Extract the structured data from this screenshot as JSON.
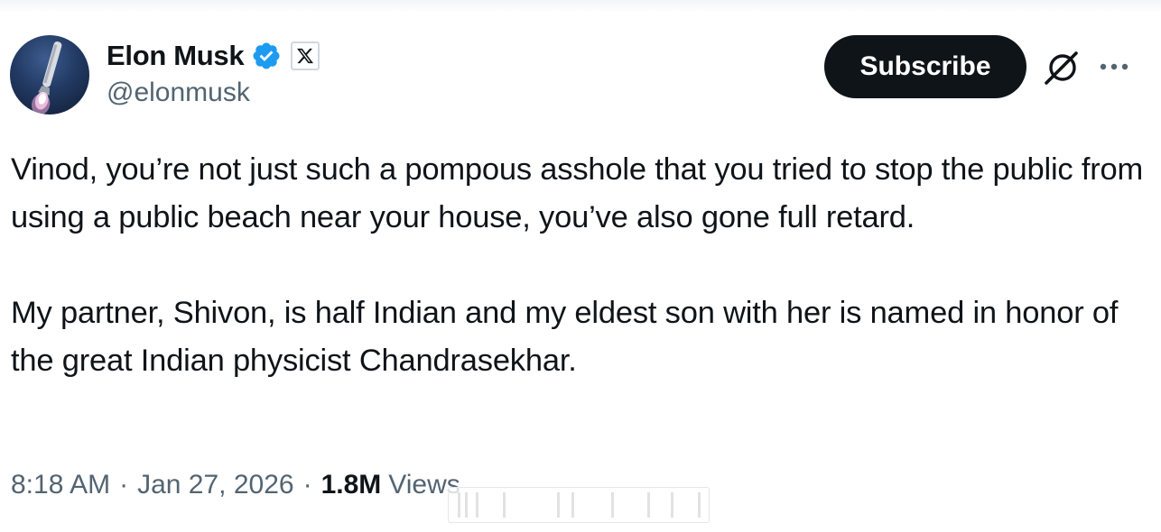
{
  "tweet": {
    "author": {
      "display_name": "Elon Musk",
      "handle": "@elonmusk",
      "verified_icon": "verified-badge-icon",
      "affiliation_icon": "x-logo-icon"
    },
    "actions": {
      "subscribe_label": "Subscribe",
      "grok_icon": "grok-icon",
      "more_icon": "more-options-icon"
    },
    "paragraphs": [
      "Vinod, you’re not just such a pompous asshole that you tried to stop the public from using a public beach near your house, you’ve also gone full retard.",
      "My partner, Shivon, is half Indian and my eldest son with her is named in honor of the great Indian physicist Chandrasekhar."
    ],
    "meta": {
      "time": "8:18 AM",
      "separator": "·",
      "date": "Jan 27, 2026",
      "views_count": "1.8M",
      "views_label": "Views"
    },
    "colors": {
      "text_primary": "#0f1419",
      "text_secondary": "#536471",
      "verified_blue": "#1d9bf0",
      "button_background": "#0f1419"
    }
  }
}
